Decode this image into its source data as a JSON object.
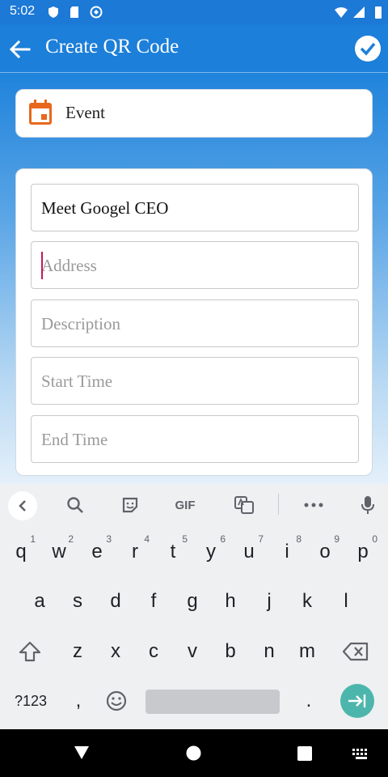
{
  "status_bar": {
    "time": "5:02",
    "left_icons": [
      "shield-icon",
      "sd-card-icon",
      "sync-icon"
    ],
    "right_icons": [
      "wifi-icon",
      "signal-icon",
      "battery-icon"
    ]
  },
  "app_bar": {
    "title": "Create QR Code",
    "back_icon": "arrow-left-icon",
    "confirm_icon": "check-circle-icon"
  },
  "qr_type": {
    "icon": "calendar-icon",
    "label": "Event",
    "accent": "#e8681d"
  },
  "form": {
    "title": {
      "value": "Meet Googel CEO",
      "placeholder": ""
    },
    "address": {
      "value": "",
      "placeholder": "Address",
      "focused": true
    },
    "description": {
      "value": "",
      "placeholder": "Description"
    },
    "start_time": {
      "value": "",
      "placeholder": "Start Time"
    },
    "end_time": {
      "value": "",
      "placeholder": "End Time"
    }
  },
  "keyboard": {
    "toolbar_gif": "GIF",
    "row1": [
      {
        "key": "q",
        "hint": "1"
      },
      {
        "key": "w",
        "hint": "2"
      },
      {
        "key": "e",
        "hint": "3"
      },
      {
        "key": "r",
        "hint": "4"
      },
      {
        "key": "t",
        "hint": "5"
      },
      {
        "key": "y",
        "hint": "6"
      },
      {
        "key": "u",
        "hint": "7"
      },
      {
        "key": "i",
        "hint": "8"
      },
      {
        "key": "o",
        "hint": "9"
      },
      {
        "key": "p",
        "hint": "0"
      }
    ],
    "row2": [
      "a",
      "s",
      "d",
      "f",
      "g",
      "h",
      "j",
      "k",
      "l"
    ],
    "row3": [
      "z",
      "x",
      "c",
      "v",
      "b",
      "n",
      "m"
    ],
    "symbols_label": "?123",
    "comma": ",",
    "period": "."
  },
  "colors": {
    "primary": "#1c7fd9",
    "enter_key": "#4db6ac",
    "caret": "#c2185b"
  }
}
